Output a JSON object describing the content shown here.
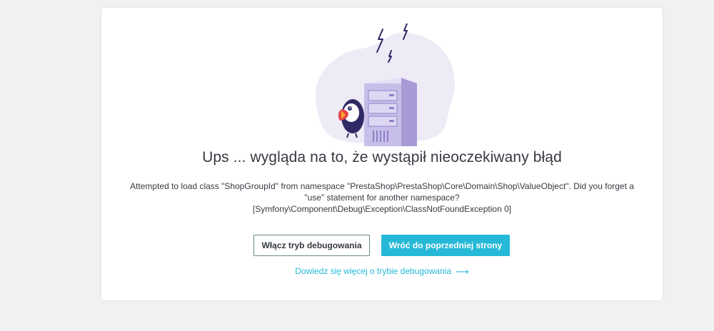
{
  "error": {
    "title": "Ups ... wygląda na to, że wystąpił nieoczekiwany błąd",
    "message_line1": "Attempted to load class \"ShopGroupId\" from namespace \"PrestaShop\\PrestaShop\\Core\\Domain\\Shop\\ValueObject\". Did you forget a",
    "message_line2": "\"use\" statement for another namespace?",
    "message_line3": "[Symfony\\Component\\Debug\\Exception\\ClassNotFoundException 0]"
  },
  "actions": {
    "debug_button_label": "Włącz tryb debugowania",
    "back_button_label": "Wróć do poprzedniej strony",
    "learn_more_link": "Dowiedz się więcej o trybie debugowania",
    "learn_more_arrow": "⟶"
  },
  "colors": {
    "accent": "#25b9d7",
    "text": "#363a41",
    "background": "#eff1f2",
    "blob": "#eeebf7",
    "server": "#c7bfe9",
    "lightning": "#2f2a66"
  },
  "icons": {
    "illustration": "server-error-illustration",
    "arrow": "arrow-right-icon"
  }
}
